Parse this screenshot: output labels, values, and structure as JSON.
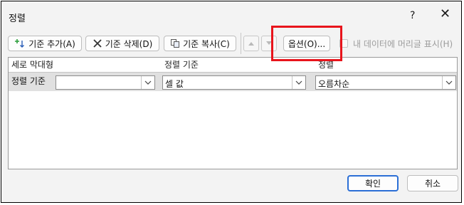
{
  "window": {
    "title": "정렬",
    "help_glyph": "?",
    "close_glyph": "✕"
  },
  "toolbar": {
    "add_level_label": "기준 추가(A)",
    "delete_level_label": "기준 삭제(D)",
    "copy_level_label": "기준 복사(C)",
    "options_label": "옵션(O)...",
    "headers_checkbox_label": "내 데이터에 머리글 표시(H)",
    "headers_checkbox_checked": false
  },
  "grid": {
    "column_headers": [
      "세로 막대형",
      "정렬 기준",
      "정렬"
    ],
    "row": {
      "label": "정렬 기준",
      "column_value": "",
      "sort_on_value": "셀 값",
      "order_value": "오름차순"
    }
  },
  "footer": {
    "ok_label": "확인",
    "cancel_label": "취소"
  },
  "colors": {
    "highlight": "#e8141c",
    "ok_border": "#2b6fd6",
    "row_bg": "#e0e0e0"
  }
}
